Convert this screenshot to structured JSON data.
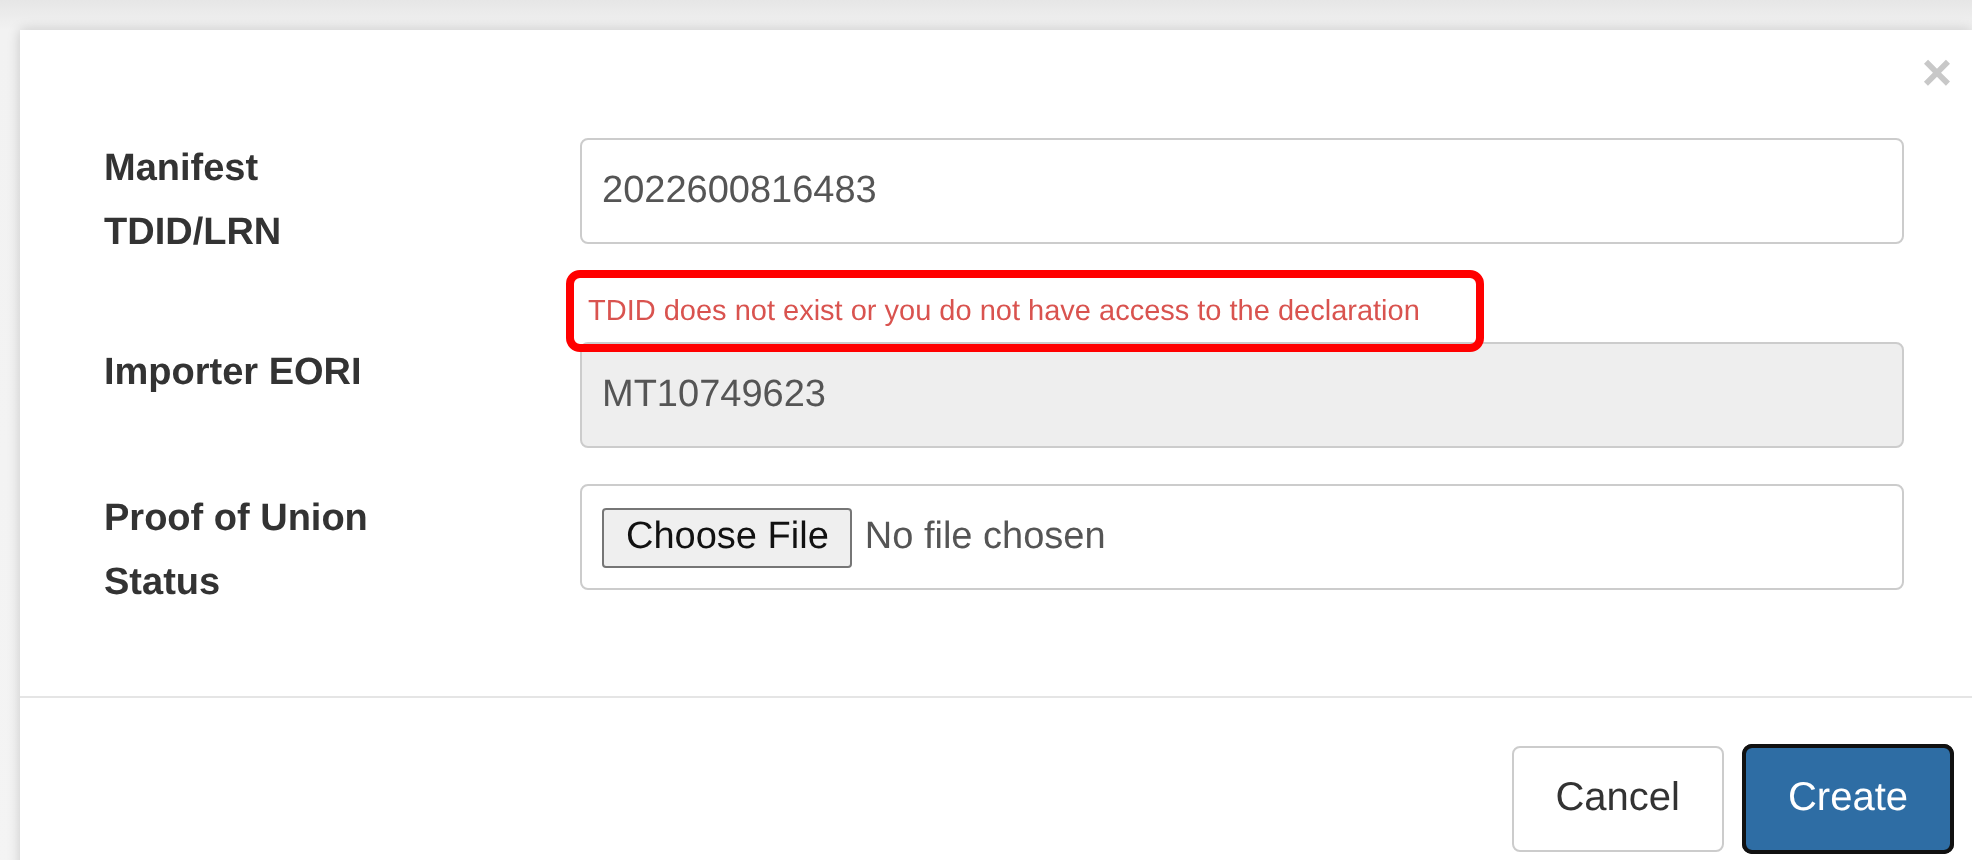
{
  "dialog": {
    "close_icon": "×",
    "fields": [
      {
        "kind": "text",
        "label": "Manifest TDID/LRN",
        "value": "2022600816483",
        "disabled": false,
        "error": {
          "text": "TDID does not exist or you do not have access to the declaration",
          "highlighted": true
        }
      },
      {
        "kind": "text",
        "label": "Importer EORI",
        "value": "MT10749623",
        "disabled": true
      },
      {
        "kind": "file",
        "label": "Proof of Union Status",
        "button": "Choose File",
        "status": "No file chosen"
      }
    ],
    "buttons": [
      {
        "label": "Cancel",
        "kind": "default",
        "focused": false
      },
      {
        "label": "Create",
        "kind": "primary",
        "focused": true
      }
    ]
  }
}
